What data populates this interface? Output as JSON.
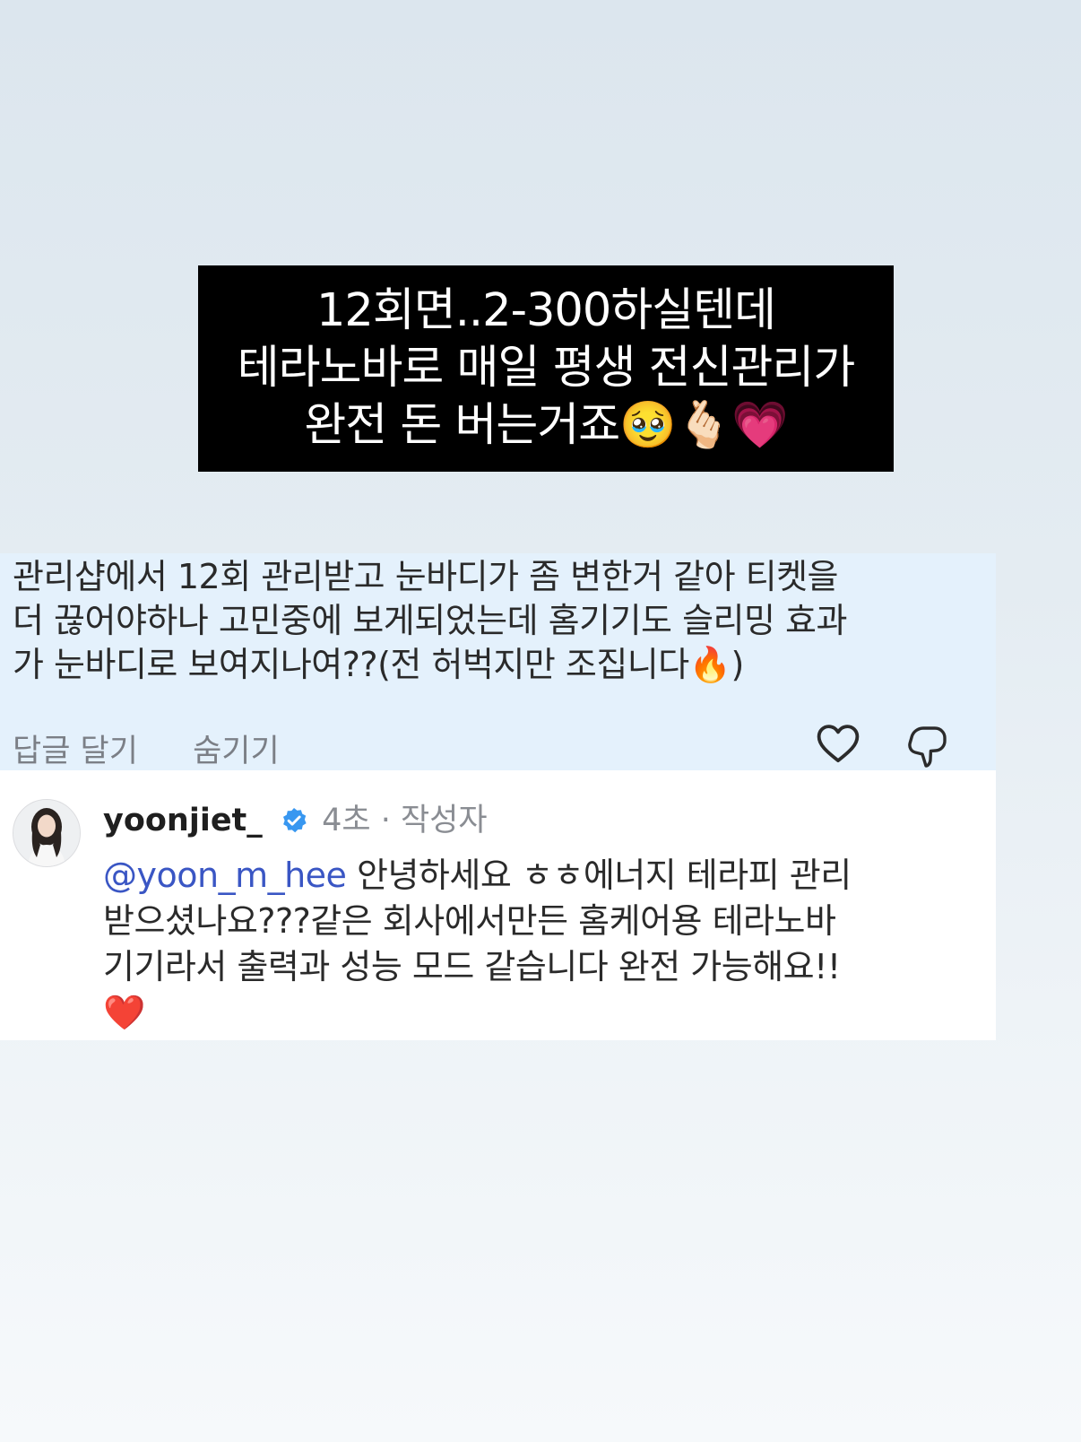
{
  "overlay": {
    "line1": "12회면..2-300하실텐데",
    "line2": "테라노바로 매일 평생 전신관리가",
    "line3": "완전 돈 버는거죠🥹🫰🏻💗"
  },
  "comment": {
    "line1": "관리샵에서 12회 관리받고 눈바디가 좀 변한거 같아 티켓을",
    "line2": "더 끊어야하나 고민중에 보게되었는데 홈기기도 슬리밍 효과",
    "line3": "가 눈바디로 보여지나여??(전 허벅지만 조집니다🔥)",
    "reply_label": "답글 달기",
    "hide_label": "숨기기"
  },
  "reply": {
    "username": "yoonjiet_",
    "time": "4초",
    "separator": "·",
    "author_badge": "작성자",
    "mention": "@yoon_m_hee",
    "line1_rest": " 안녕하세요 ㅎㅎ에너지 테라피 관리",
    "line2": "받으셨나요???같은 회사에서만든 홈케어용 테라노바",
    "line3": "기기라서 출력과 성능 모드 같습니다 완전 가능해요!!",
    "line4": "❤️"
  },
  "colors": {
    "comment_bg": "#e4f1fc",
    "mention": "#3a56c4",
    "verified": "#3897f0",
    "muted": "#7b7f86"
  },
  "icons": [
    "heart-icon",
    "dislike-icon",
    "verified-icon",
    "avatar"
  ]
}
